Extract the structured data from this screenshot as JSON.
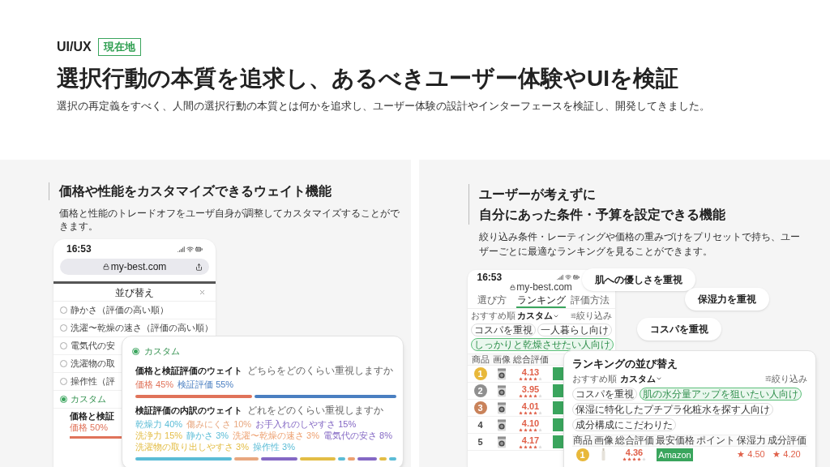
{
  "header": {
    "category": "UI/UX",
    "badge": "現在地",
    "title": "選択行動の本質を追求し、あるべきユーザー体験やUIを検証",
    "description": "選択の再定義をすべく、人間の選択行動の本質とは何かを追求し、ユーザー体験の設計やインターフェースを検証し、開発してきました。"
  },
  "weight_feature": {
    "title": "価格や性能をカスタマイズできるウェイト機能",
    "description": "価格と性能のトレードオフをユーザ自身が調整してカスタマイズすることができます。",
    "phone": {
      "time": "16:53",
      "url": "my-best.com",
      "sheet_title": "並び替え",
      "options": [
        {
          "label": "静かさ（評価の高い順）",
          "selected": false
        },
        {
          "label": "洗濯〜乾燥の速さ（評価の高い順）",
          "selected": false
        },
        {
          "label": "電気代の安",
          "selected": false
        },
        {
          "label": "洗濯物の取",
          "selected": false
        },
        {
          "label": "操作性（評",
          "selected": false
        },
        {
          "label": "カスタム",
          "selected": true
        }
      ],
      "custom_group": "価格と検証",
      "custom_weights": [
        {
          "label": "価格 50%",
          "color": "#e0735a",
          "level": 0.5
        }
      ]
    },
    "panel": {
      "option": {
        "label": "カスタム",
        "selected": true
      },
      "groups": [
        {
          "title": "価格と検証評価のウェイト",
          "hint": "どちらをどのくらい重視しますか",
          "weights": [
            {
              "label": "価格 45%",
              "color": "#e0735a"
            },
            {
              "label": "検証評価 55%",
              "color": "#4a7fc1"
            }
          ]
        },
        {
          "title": "検証評価の内訳のウェイト",
          "hint": "どれをどのくらい重視しますか",
          "weights": [
            {
              "label": "乾燥力 40%",
              "color": "#5bbcd6"
            },
            {
              "label": "傷みにくさ 10%",
              "color": "#e8a77f"
            },
            {
              "label": "お手入れのしやすさ 15%",
              "color": "#8468c4"
            },
            {
              "label": "洗浄力 15%",
              "color": "#e3bd45"
            },
            {
              "label": "静かさ 3%",
              "color": "#5bbcd6"
            },
            {
              "label": "洗濯〜乾燥の速さ 3%",
              "color": "#eda070"
            },
            {
              "label": "電気代の安さ 8%",
              "color": "#8468c4"
            },
            {
              "label": "洗濯物の取り出しやすさ 3%",
              "color": "#e3bd45"
            },
            {
              "label": "操作性 3%",
              "color": "#5bbcd6"
            }
          ]
        }
      ]
    }
  },
  "preset_feature": {
    "title_lines": [
      "ユーザーが考えずに",
      "自分にあった条件・予算を設定できる機能"
    ],
    "description": "絞り込み条件・レーティングや価格の重みづけをプリセットで持ち、ユーザーごとに最適なランキングを見ることができます。",
    "phone": {
      "time": "16:53",
      "url": "my-best.com",
      "tabs": [
        {
          "label": "選び方",
          "selected": false
        },
        {
          "label": "ランキング",
          "selected": true
        },
        {
          "label": "評価方法",
          "selected": false
        }
      ],
      "sort_label": "おすすめ順",
      "sort_value": "カスタム",
      "filter": "絞り込み",
      "chips": [
        {
          "label": "コスパを重視",
          "selected": false
        },
        {
          "label": "一人暮らし向け",
          "selected": false
        },
        {
          "label": "しっかりと乾燥させたい人向け",
          "selected": true
        }
      ],
      "columns": [
        "商品",
        "画像",
        "総合評価"
      ],
      "rows": [
        {
          "rank": "1",
          "color": "#e8b83a",
          "score": "4.13",
          "stars": 4
        },
        {
          "rank": "2",
          "color": "#8f8f8f",
          "score": "3.95",
          "stars": 4
        },
        {
          "rank": "3",
          "color": "#c9825a",
          "score": "4.01",
          "stars": 4
        },
        {
          "rank": "4",
          "score": "4.10",
          "stars": 4
        },
        {
          "rank": "5",
          "score": "4.17",
          "stars": 4
        }
      ]
    },
    "bubbles": [
      "肌への優しさを重視",
      "保湿力を重視",
      "コスパを重視"
    ],
    "panel": {
      "title": "ランキングの並び替え",
      "sort_label": "おすすめ順",
      "sort_value": "カスタム",
      "filter": "絞り込み",
      "chips": [
        {
          "label": "コスパを重視",
          "selected": false
        },
        {
          "label": "肌の水分量アップを狙いたい人向け",
          "selected": true
        },
        {
          "label": "保湿に特化したプチプラ化粧水を探す人向け",
          "selected": false
        },
        {
          "label": "成分構成にこだわりた",
          "selected": false
        }
      ],
      "columns": [
        "商品",
        "画像",
        "総合評価",
        "最安価格",
        "ポイント",
        "保湿力",
        "成分評価"
      ],
      "rows": [
        {
          "rank": "1",
          "color": "#e8b83a",
          "score": "4.36",
          "stars": 4,
          "store": "Amazon",
          "ratings": [
            "★ 4.50",
            "★ 4.20"
          ]
        }
      ]
    }
  }
}
